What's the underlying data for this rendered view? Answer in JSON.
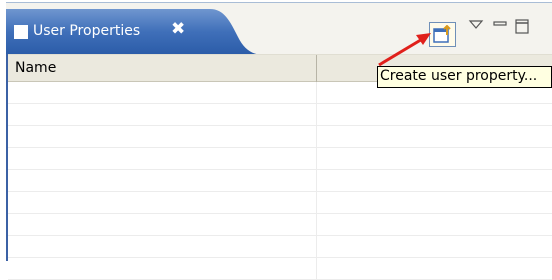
{
  "view": {
    "title": "User Properties",
    "close_glyph": "✖",
    "icon": "view-icon",
    "colors": {
      "tab_active": "#2b5ca8",
      "tab_light": "#6f96cf",
      "arrow": "#e0201b",
      "tooltip_bg": "#ffffe1"
    }
  },
  "toolbar": {
    "create_button": {
      "icon": "create-user-property-icon",
      "tooltip": "Create user property..."
    },
    "view_menu": {
      "icon": "chevron-down-icon"
    },
    "minimize": {
      "icon": "minimize-icon"
    },
    "maximize": {
      "icon": "maximize-icon"
    }
  },
  "table": {
    "columns": [
      "Name",
      ""
    ],
    "rows": [
      [
        "",
        ""
      ],
      [
        "",
        ""
      ],
      [
        "",
        ""
      ],
      [
        "",
        ""
      ],
      [
        "",
        ""
      ],
      [
        "",
        ""
      ],
      [
        "",
        ""
      ],
      [
        "",
        ""
      ],
      [
        "",
        ""
      ]
    ]
  }
}
